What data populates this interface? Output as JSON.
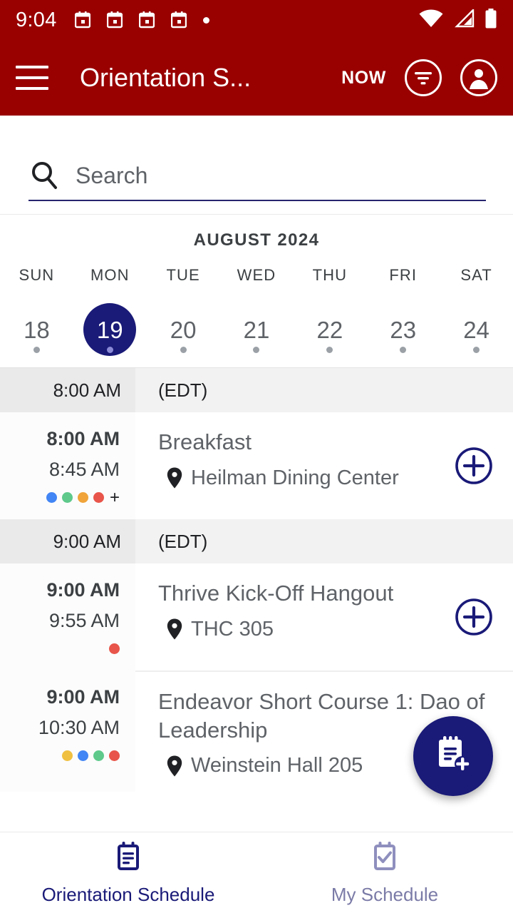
{
  "status_bar": {
    "time": "9:04",
    "notification_icons": [
      "calendar-icon",
      "calendar-icon",
      "calendar-icon",
      "calendar-icon",
      "dot-icon"
    ],
    "right_icons": [
      "wifi-icon",
      "cellular-signal-icon",
      "battery-icon"
    ]
  },
  "app_bar": {
    "menu_icon": "hamburger-menu-icon",
    "title": "Orientation S...",
    "now_label": "NOW",
    "filter_icon": "filter-icon",
    "account_icon": "account-circle-icon",
    "background_color": "#990000"
  },
  "search": {
    "icon": "search-icon",
    "placeholder": "Search",
    "value": "",
    "underline_color": "#26246e"
  },
  "calendar": {
    "month_label": "AUGUST 2024",
    "selected_color": "#1a1a78",
    "days": [
      {
        "dow": "SUN",
        "date": "18",
        "selected": false,
        "has_events": true
      },
      {
        "dow": "MON",
        "date": "19",
        "selected": true,
        "has_events": true
      },
      {
        "dow": "TUE",
        "date": "20",
        "selected": false,
        "has_events": true
      },
      {
        "dow": "WED",
        "date": "21",
        "selected": false,
        "has_events": true
      },
      {
        "dow": "THU",
        "date": "22",
        "selected": false,
        "has_events": true
      },
      {
        "dow": "FRI",
        "date": "23",
        "selected": false,
        "has_events": true
      },
      {
        "dow": "SAT",
        "date": "24",
        "selected": false,
        "has_events": true
      }
    ]
  },
  "schedule": {
    "groups": [
      {
        "hour_label": "8:00 AM",
        "timezone": "(EDT)",
        "events": [
          {
            "start": "8:00 AM",
            "end": "8:45 AM",
            "title": "Breakfast",
            "location": "Heilman Dining Center",
            "location_icon": "map-pin-icon",
            "add_icon": "add-circle-icon",
            "tag_colors": [
              "#4285f4",
              "#5ec98b",
              "#f0a43a",
              "#e8554a"
            ],
            "tag_overflow": "+"
          }
        ]
      },
      {
        "hour_label": "9:00 AM",
        "timezone": "(EDT)",
        "events": [
          {
            "start": "9:00 AM",
            "end": "9:55 AM",
            "title": "Thrive Kick-Off Hangout",
            "location": "THC 305",
            "location_icon": "map-pin-icon",
            "add_icon": "add-circle-icon",
            "tag_colors": [
              "#e8554a"
            ],
            "tag_overflow": ""
          },
          {
            "start": "9:00 AM",
            "end": "10:30 AM",
            "title": "Endeavor Short Course 1: Dao of Leadership",
            "location": "Weinstein Hall 205",
            "location_icon": "map-pin-icon",
            "add_icon": "",
            "tag_colors": [
              "#f0c040",
              "#4285f4",
              "#5ec98b",
              "#e8554a"
            ],
            "tag_overflow": ""
          }
        ]
      }
    ]
  },
  "fab": {
    "icon": "note-add-icon",
    "color": "#1a1a78"
  },
  "bottom_nav": {
    "items": [
      {
        "label": "Orientation Schedule",
        "icon": "clipboard-list-icon",
        "active": true
      },
      {
        "label": "My Schedule",
        "icon": "clipboard-check-icon",
        "active": false
      }
    ]
  }
}
